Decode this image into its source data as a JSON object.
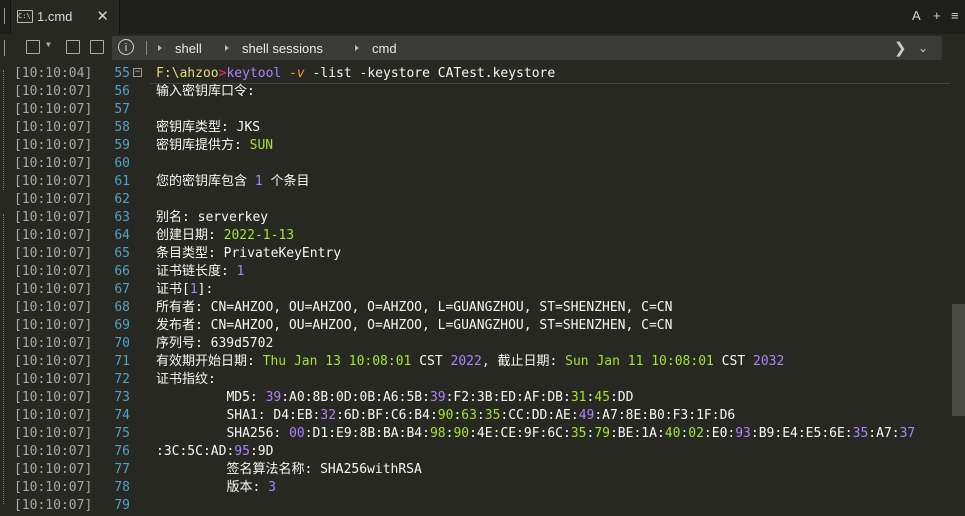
{
  "tab": {
    "title": "1.cmd",
    "close": "✕"
  },
  "tabbar_right": {
    "font": "A",
    "new": "+",
    "menu": "≡"
  },
  "breadcrumb": [
    "shell",
    "shell sessions",
    "cmd"
  ],
  "lines": [
    {
      "ts": "[10:10:04]",
      "n": "55",
      "segs": [
        {
          "t": "F:\\ahzoo",
          "c": "y"
        },
        {
          "t": ">",
          "c": "p"
        },
        {
          "t": "keytool",
          "c": "v"
        },
        {
          "t": " "
        },
        {
          "t": "-v",
          "c": "o it"
        },
        {
          "t": " -list -keystore CATest.keystore"
        }
      ]
    },
    {
      "ts": "[10:10:07]",
      "n": "56",
      "segs": [
        {
          "t": "输入密钥库口令:"
        }
      ]
    },
    {
      "ts": "[10:10:07]",
      "n": "57",
      "segs": []
    },
    {
      "ts": "[10:10:07]",
      "n": "58",
      "segs": [
        {
          "t": "密钥库类型: JKS"
        }
      ]
    },
    {
      "ts": "[10:10:07]",
      "n": "59",
      "segs": [
        {
          "t": "密钥库提供方: "
        },
        {
          "t": "SUN",
          "c": "g"
        }
      ]
    },
    {
      "ts": "[10:10:07]",
      "n": "60",
      "segs": []
    },
    {
      "ts": "[10:10:07]",
      "n": "61",
      "segs": [
        {
          "t": "您的密钥库包含 "
        },
        {
          "t": "1",
          "c": "v"
        },
        {
          "t": " 个条目"
        }
      ]
    },
    {
      "ts": "[10:10:07]",
      "n": "62",
      "segs": []
    },
    {
      "ts": "[10:10:07]",
      "n": "63",
      "segs": [
        {
          "t": "别名: serverkey"
        }
      ]
    },
    {
      "ts": "[10:10:07]",
      "n": "64",
      "segs": [
        {
          "t": "创建日期: "
        },
        {
          "t": "2022-1-13",
          "c": "g"
        }
      ]
    },
    {
      "ts": "[10:10:07]",
      "n": "65",
      "segs": [
        {
          "t": "条目类型: PrivateKeyEntry"
        }
      ]
    },
    {
      "ts": "[10:10:07]",
      "n": "66",
      "segs": [
        {
          "t": "证书链长度: "
        },
        {
          "t": "1",
          "c": "v"
        }
      ]
    },
    {
      "ts": "[10:10:07]",
      "n": "67",
      "segs": [
        {
          "t": "证书["
        },
        {
          "t": "1",
          "c": "v"
        },
        {
          "t": "]:"
        }
      ]
    },
    {
      "ts": "[10:10:07]",
      "n": "68",
      "segs": [
        {
          "t": "所有者: CN=AHZOO, OU=AHZOO, O=AHZOO, L=GUANGZHOU, ST=SHENZHEN, C=CN"
        }
      ]
    },
    {
      "ts": "[10:10:07]",
      "n": "69",
      "segs": [
        {
          "t": "发布者: CN=AHZOO, OU=AHZOO, O=AHZOO, L=GUANGZHOU, ST=SHENZHEN, C=CN"
        }
      ]
    },
    {
      "ts": "[10:10:07]",
      "n": "70",
      "segs": [
        {
          "t": "序列号: 639d5702"
        }
      ]
    },
    {
      "ts": "[10:10:07]",
      "n": "71",
      "segs": [
        {
          "t": "有效期开始日期: "
        },
        {
          "t": "Thu Jan 13 10:08:01",
          "c": "g"
        },
        {
          "t": " CST "
        },
        {
          "t": "2022",
          "c": "v"
        },
        {
          "t": ", 截止日期: "
        },
        {
          "t": "Sun Jan 11 10:08:01",
          "c": "g"
        },
        {
          "t": " CST "
        },
        {
          "t": "2032",
          "c": "v"
        }
      ]
    },
    {
      "ts": "[10:10:07]",
      "n": "72",
      "segs": [
        {
          "t": "证书指纹:"
        }
      ]
    },
    {
      "ts": "[10:10:07]",
      "n": "73",
      "segs": [
        {
          "t": "         MD5: "
        },
        {
          "t": "39",
          "c": "v"
        },
        {
          "t": ":A0:8B:0D:0B:A6:5B:"
        },
        {
          "t": "39",
          "c": "v"
        },
        {
          "t": ":F2:3B:ED:AF:DB:"
        },
        {
          "t": "31",
          "c": "g"
        },
        {
          "t": ":"
        },
        {
          "t": "45",
          "c": "g"
        },
        {
          "t": ":DD"
        }
      ]
    },
    {
      "ts": "[10:10:07]",
      "n": "74",
      "segs": [
        {
          "t": "         SHA1: D4:EB:"
        },
        {
          "t": "32",
          "c": "v"
        },
        {
          "t": ":6D:BF:C6:B4:"
        },
        {
          "t": "90",
          "c": "g"
        },
        {
          "t": ":"
        },
        {
          "t": "63",
          "c": "g"
        },
        {
          "t": ":"
        },
        {
          "t": "35",
          "c": "g"
        },
        {
          "t": ":CC:DD:AE:"
        },
        {
          "t": "49",
          "c": "v"
        },
        {
          "t": ":A7:8E:B0:F3:1F:D6"
        }
      ]
    },
    {
      "ts": "[10:10:07]",
      "n": "75",
      "segs": [
        {
          "t": "         SHA256: "
        },
        {
          "t": "00",
          "c": "v"
        },
        {
          "t": ":D1:E9:8B:BA:B4:"
        },
        {
          "t": "98",
          "c": "g"
        },
        {
          "t": ":"
        },
        {
          "t": "90",
          "c": "g"
        },
        {
          "t": ":4E:CE:9F:6C:"
        },
        {
          "t": "35",
          "c": "g"
        },
        {
          "t": ":"
        },
        {
          "t": "79",
          "c": "g"
        },
        {
          "t": ":BE:1A:"
        },
        {
          "t": "40",
          "c": "g"
        },
        {
          "t": ":"
        },
        {
          "t": "02",
          "c": "g"
        },
        {
          "t": ":E0:"
        },
        {
          "t": "93",
          "c": "v"
        },
        {
          "t": ":B9:E4:E5:6E:"
        },
        {
          "t": "35",
          "c": "v"
        },
        {
          "t": ":A7:"
        },
        {
          "t": "37",
          "c": "v"
        }
      ]
    },
    {
      "ts": "[10:10:07]",
      "n": "76",
      "segs": [
        {
          "t": ":3C:5C:AD:"
        },
        {
          "t": "95",
          "c": "v"
        },
        {
          "t": ":9D"
        }
      ],
      "wrap": true
    },
    {
      "ts": "[10:10:07]",
      "n": "77",
      "segs": [
        {
          "t": "         签名算法名称: SHA256withRSA"
        }
      ]
    },
    {
      "ts": "[10:10:07]",
      "n": "78",
      "segs": [
        {
          "t": "         版本: "
        },
        {
          "t": "3",
          "c": "v"
        }
      ]
    },
    {
      "ts": "[10:10:07]",
      "n": "79",
      "segs": []
    }
  ]
}
